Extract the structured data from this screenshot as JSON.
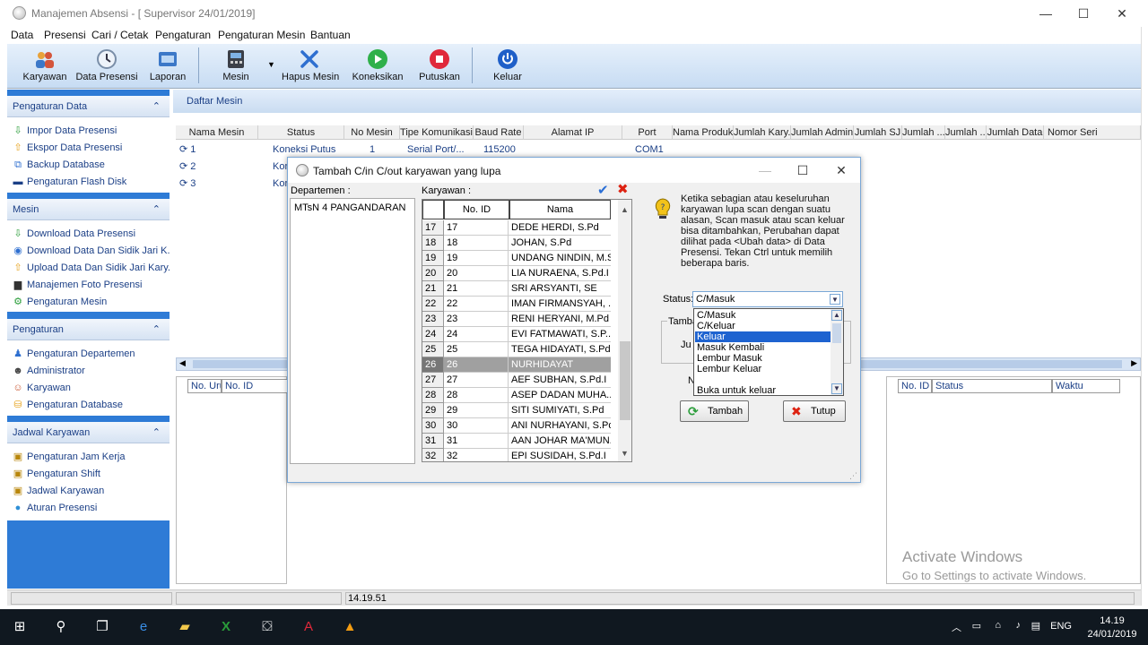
{
  "window": {
    "title": "Manajemen Absensi - [ Supervisor 24/01/2019]",
    "controls": {
      "minimize": "—",
      "maximize": "☐",
      "close": "✕"
    }
  },
  "menu": [
    "Data",
    "Presensi",
    "Cari / Cetak",
    "Pengaturan",
    "Pengaturan Mesin",
    "Bantuan"
  ],
  "toolbar": {
    "karyawan": "Karyawan",
    "data_presensi": "Data Presensi",
    "laporan": "Laporan",
    "mesin": "Mesin",
    "hapus_mesin": "Hapus Mesin",
    "koneksikan": "Koneksikan",
    "putuskan": "Putuskan",
    "keluar": "Keluar"
  },
  "sidebar": {
    "pengaturan_data": {
      "title": "Pengaturan Data",
      "items": [
        "Impor Data Presensi",
        "Ekspor Data Presensi",
        "Backup Database",
        "Pengaturan Flash Disk"
      ]
    },
    "mesin": {
      "title": "Mesin",
      "items": [
        "Download Data Presensi",
        "Download Data Dan Sidik Jari K...",
        "Upload Data Dan Sidik Jari Kary...",
        "Manajemen Foto Presensi",
        "Pengaturan Mesin"
      ]
    },
    "pengaturan": {
      "title": "Pengaturan",
      "items": [
        "Pengaturan Departemen",
        "Administrator",
        "Karyawan",
        "Pengaturan Database"
      ]
    },
    "jadwal": {
      "title": "Jadwal Karyawan",
      "items": [
        "Pengaturan Jam Kerja",
        "Pengaturan Shift",
        "Jadwal Karyawan",
        "Aturan Presensi"
      ]
    }
  },
  "mesin_panel": {
    "title": "Daftar Mesin",
    "columns": [
      "Nama Mesin",
      "Status",
      "No Mesin",
      "Tipe Komunikasi",
      "Baud Rate",
      "Alamat IP",
      "Port",
      "Nama Produk",
      "Jumlah Kary...",
      "Jumlah Admin",
      "Jumlah SJ",
      "Jumlah ...",
      "Jumlah ...",
      "Jumlah Data",
      "Nomor Seri"
    ],
    "rows": [
      {
        "nama": "1",
        "status": "Koneksi Putus",
        "no": "1",
        "tipe": "Serial Port/...",
        "baud": "115200",
        "port": "COM1"
      },
      {
        "nama": "2",
        "status": "Kor"
      },
      {
        "nama": "3",
        "status": "Kor"
      }
    ]
  },
  "bottom_left_cols": [
    "No. Urut",
    "No. ID"
  ],
  "bottom_right_cols": [
    "No. ID",
    "Status",
    "Waktu"
  ],
  "statusbar": {
    "time": "14.19.51"
  },
  "activate": {
    "line1": "Activate Windows",
    "line2": "Go to Settings to activate Windows."
  },
  "dialog": {
    "title": "Tambah C/in C/out karyawan yang lupa",
    "departemen_label": "Departemen :",
    "departemen": "MTsN 4 PANGANDARAN",
    "karyawan_label": "Karyawan :",
    "columns": [
      "No. ID",
      "Nama"
    ],
    "rows": [
      {
        "n": "17",
        "id": "17",
        "nama": "DEDE HERDI, S.Pd"
      },
      {
        "n": "18",
        "id": "18",
        "nama": "JOHAN, S.Pd"
      },
      {
        "n": "19",
        "id": "19",
        "nama": "UNDANG NINDIN, M.Si"
      },
      {
        "n": "20",
        "id": "20",
        "nama": "LIA NURAENA, S.Pd.I"
      },
      {
        "n": "21",
        "id": "21",
        "nama": "SRI ARSYANTI, SE"
      },
      {
        "n": "22",
        "id": "22",
        "nama": "IMAN FIRMANSYAH, ..."
      },
      {
        "n": "23",
        "id": "23",
        "nama": "RENI HERYANI, M.Pd"
      },
      {
        "n": "24",
        "id": "24",
        "nama": "EVI FATMAWATI, S.P..."
      },
      {
        "n": "25",
        "id": "25",
        "nama": "TEGA HIDAYATI, S.Pd"
      },
      {
        "n": "26",
        "id": "26",
        "nama": "NURHIDAYAT"
      },
      {
        "n": "27",
        "id": "27",
        "nama": "AEF SUBHAN, S.Pd.I"
      },
      {
        "n": "28",
        "id": "28",
        "nama": "ASEP DADAN MUHA..."
      },
      {
        "n": "29",
        "id": "29",
        "nama": "SITI SUMIYATI, S.Pd"
      },
      {
        "n": "30",
        "id": "30",
        "nama": "ANI NURHAYANI, S.Pd"
      },
      {
        "n": "31",
        "id": "31",
        "nama": "AAN JOHAR MA'MUN..."
      },
      {
        "n": "32",
        "id": "32",
        "nama": "EPI SUSIDAH, S.Pd.I"
      }
    ],
    "info": "Ketika sebagian atau keseluruhan karyawan lupa scan dengan suatu alasan, Scan masuk atau scan keluar bisa ditambahkan, Perubahan dapat dilihat pada <Ubah data> di Data Presensi. Tekan Ctrl untuk memilih beberapa baris.",
    "status_label": "Status:",
    "status_value": "C/Masuk",
    "status_options": [
      "C/Masuk",
      "C/Keluar",
      "Keluar",
      "Masuk Kembali",
      "Lembur Masuk",
      "Lembur Keluar",
      "Buka untuk keluar"
    ],
    "tambah_group": "Tamba",
    "ju": "Ju",
    "n_label": "N",
    "btn_tambah": "Tambah",
    "btn_tutup": "Tutup"
  },
  "taskbar": {
    "time": "14.19",
    "date": "24/01/2019",
    "lang": "ENG"
  }
}
